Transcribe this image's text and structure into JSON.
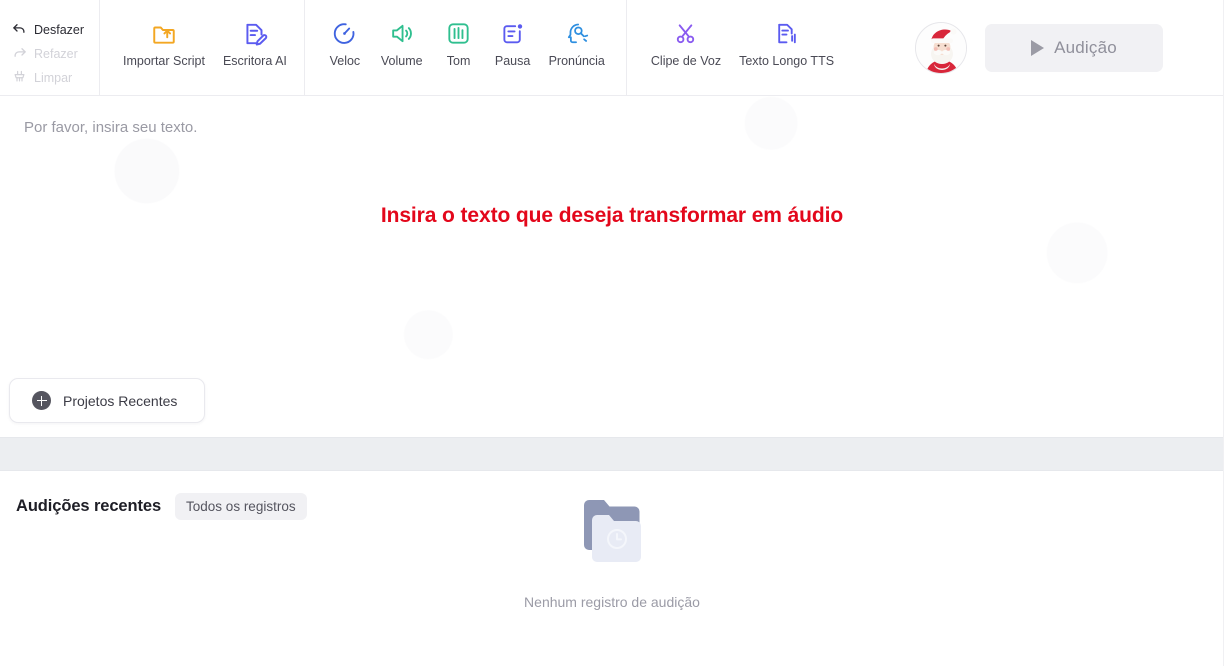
{
  "toolbar": {
    "history": [
      {
        "label": "Desfazer",
        "icon": "undo-arrow-icon",
        "state": "enabled"
      },
      {
        "label": "Refazer",
        "icon": "redo-arrow-icon",
        "state": "disabled"
      },
      {
        "label": "Limpar",
        "icon": "broom-icon",
        "state": "disabled"
      }
    ],
    "import_group": [
      {
        "label": "Importar Script",
        "icon": "folder-upload-icon",
        "color": "#f3a723"
      },
      {
        "label": "Escritora AI",
        "icon": "document-pencil-icon",
        "color": "#5b5bf0"
      }
    ],
    "voice_group": [
      {
        "label": "Veloc",
        "icon": "stopwatch-icon",
        "color": "#3f63e0"
      },
      {
        "label": "Volume",
        "icon": "speaker-icon",
        "color": "#2fbf8f"
      },
      {
        "label": "Tom",
        "icon": "equalizer-icon",
        "color": "#2fbf8f"
      },
      {
        "label": "Pausa",
        "icon": "pause-note-icon",
        "color": "#5b5bf0"
      },
      {
        "label": "Pronúncia",
        "icon": "pronunciation-head-icon",
        "color": "#2e8fe0"
      }
    ],
    "clip_group": [
      {
        "label": "Clipe de Voz",
        "icon": "scissors-icon",
        "color": "#8a5bf0"
      },
      {
        "label": "Texto Longo TTS",
        "icon": "long-text-tts-icon",
        "color": "#5b5bf0"
      }
    ],
    "avatar": {
      "name": "santa-claus-avatar",
      "alt": "Santa Claus"
    },
    "audition": {
      "label": "Audição",
      "icon": "play-icon"
    }
  },
  "editor": {
    "placeholder": "Por favor, insira seu texto.",
    "annotation": "Insira o texto que deseja transformar em áudio",
    "annotation_color": "#e3071b",
    "recent_projects_label": "Projetos Recentes"
  },
  "history_panel": {
    "title": "Audições recentes",
    "chip_label": "Todos os registros",
    "empty_label": "Nenhum registro de audição",
    "empty_icon": "empty-folder-clock-icon"
  }
}
